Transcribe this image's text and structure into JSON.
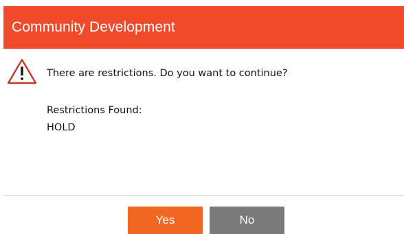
{
  "dialog": {
    "title": "Community Development",
    "message": "There are restrictions. Do you want to continue?",
    "restrictions_label": "Restrictions Found:",
    "restrictions_value": "HOLD",
    "icon": "warning-icon",
    "buttons": {
      "yes_label": "Yes",
      "no_label": "No"
    }
  },
  "colors": {
    "header": "#ef4a2b",
    "yes_button": "#f26522",
    "no_button": "#7a7a7a",
    "warning": "#c0392b"
  }
}
